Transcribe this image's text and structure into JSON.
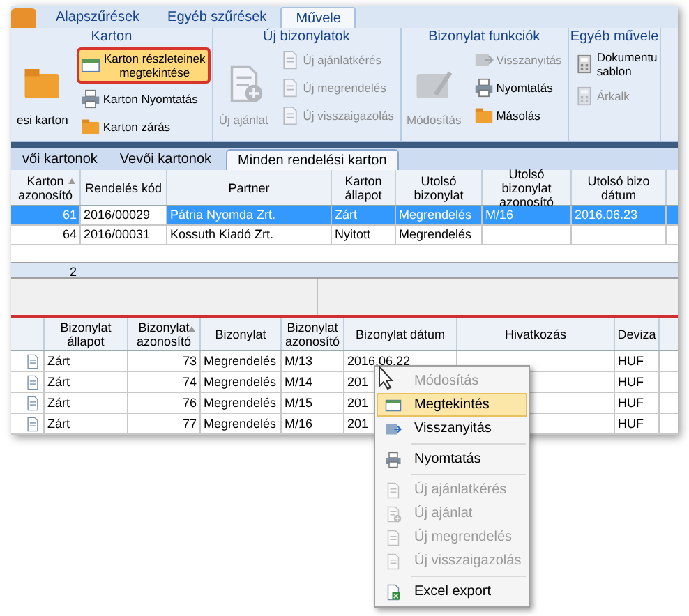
{
  "ribbon_tabs": [
    {
      "label": "Alapszűrések",
      "selected": false
    },
    {
      "label": "Egyéb szűrések",
      "selected": false
    },
    {
      "label": "Művele",
      "selected": true
    }
  ],
  "ribbon_groups": [
    {
      "title": "Karton",
      "items": [
        {
          "label": "esi karton",
          "kind": "large",
          "disabled": false,
          "highlighted": false
        },
        {
          "label": "Karton részleteinek megtekintése",
          "kind": "small",
          "disabled": false,
          "highlighted": true
        },
        {
          "label": "Karton Nyomtatás",
          "kind": "small",
          "disabled": false,
          "highlighted": false
        },
        {
          "label": "Karton zárás",
          "kind": "small",
          "disabled": false,
          "highlighted": false
        }
      ]
    },
    {
      "title": "Új bizonylatok",
      "items": [
        {
          "label": "Új ajánlat",
          "kind": "large",
          "disabled": true,
          "highlighted": false
        },
        {
          "label": "Új ajánlatkérés",
          "kind": "small",
          "disabled": true,
          "highlighted": false
        },
        {
          "label": "Új megrendelés",
          "kind": "small",
          "disabled": true,
          "highlighted": false
        },
        {
          "label": "Új visszaigazolás",
          "kind": "small",
          "disabled": true,
          "highlighted": false
        }
      ]
    },
    {
      "title": "Bizonylat funkciók",
      "items": [
        {
          "label": "Módosítás",
          "kind": "large",
          "disabled": true,
          "highlighted": false
        },
        {
          "label": "Visszanyitás",
          "kind": "small",
          "disabled": true,
          "highlighted": false
        },
        {
          "label": "Nyomtatás",
          "kind": "small",
          "disabled": false,
          "highlighted": false
        },
        {
          "label": "Másolás",
          "kind": "small",
          "disabled": false,
          "highlighted": false
        }
      ]
    },
    {
      "title": "Egyéb művele",
      "items": [
        {
          "label": "Dokumentu sablon",
          "kind": "small",
          "disabled": false,
          "highlighted": false
        },
        {
          "label": "Árkalk",
          "kind": "small",
          "disabled": true,
          "highlighted": false
        }
      ]
    }
  ],
  "grid_tabs": [
    {
      "label": "vői kartonok",
      "selected": false
    },
    {
      "label": "Vevői kartonok",
      "selected": false
    },
    {
      "label": "Minden rendelési karton",
      "selected": true
    }
  ],
  "cards_table": {
    "columns": [
      "Karton azonosító",
      "Rendelés kód",
      "Partner",
      "Karton állapot",
      "Utolsó bizonylat",
      "Utolsó bizonylat azonosító",
      "Utolsó bizo dátum"
    ],
    "rows": [
      {
        "selected": true,
        "cells": [
          "61",
          "2016/00029",
          "Pátria Nyomda Zrt.",
          "Zárt",
          "Megrendelés",
          "M/16",
          "2016.06.23"
        ]
      },
      {
        "selected": false,
        "cells": [
          "64",
          "2016/00031",
          "Kossuth Kiadó Zrt.",
          "Nyitott",
          "Megrendelés",
          "",
          ""
        ]
      }
    ],
    "footer_count": "2"
  },
  "documents_table": {
    "columns": [
      "Bizonylat állapot",
      "Bizonylat azonosító",
      "Bizonylat",
      "Bizonylat azonosító",
      "Bizonylat dátum",
      "Hivatkozás",
      "Deviza"
    ],
    "rows": [
      {
        "cells": [
          "Zárt",
          "73",
          "Megrendelés",
          "M/13",
          "2016.06.22",
          "",
          "HUF"
        ]
      },
      {
        "cells": [
          "Zárt",
          "74",
          "Megrendelés",
          "M/14",
          "201",
          "",
          "HUF"
        ]
      },
      {
        "cells": [
          "Zárt",
          "76",
          "Megrendelés",
          "M/15",
          "201",
          "",
          "HUF"
        ]
      },
      {
        "cells": [
          "Zárt",
          "77",
          "Megrendelés",
          "M/16",
          "201",
          "",
          "HUF"
        ]
      }
    ]
  },
  "context_menu": {
    "items": [
      {
        "kind": "item",
        "label": "Módosítás",
        "disabled": true,
        "highlighted": false
      },
      {
        "kind": "item",
        "label": "Megtekintés",
        "disabled": false,
        "highlighted": true
      },
      {
        "kind": "item",
        "label": "Visszanyitás",
        "disabled": false,
        "highlighted": false
      },
      {
        "kind": "separator"
      },
      {
        "kind": "item",
        "label": "Nyomtatás",
        "disabled": false,
        "highlighted": false
      },
      {
        "kind": "separator"
      },
      {
        "kind": "item",
        "label": "Új ajánlatkérés",
        "disabled": true,
        "highlighted": false
      },
      {
        "kind": "item",
        "label": "Új ajánlat",
        "disabled": true,
        "highlighted": false
      },
      {
        "kind": "item",
        "label": "Új megrendelés",
        "disabled": true,
        "highlighted": false
      },
      {
        "kind": "item",
        "label": "Új visszaigazolás",
        "disabled": true,
        "highlighted": false
      },
      {
        "kind": "separator"
      },
      {
        "kind": "item",
        "label": "Excel export",
        "disabled": false,
        "highlighted": false
      }
    ]
  }
}
